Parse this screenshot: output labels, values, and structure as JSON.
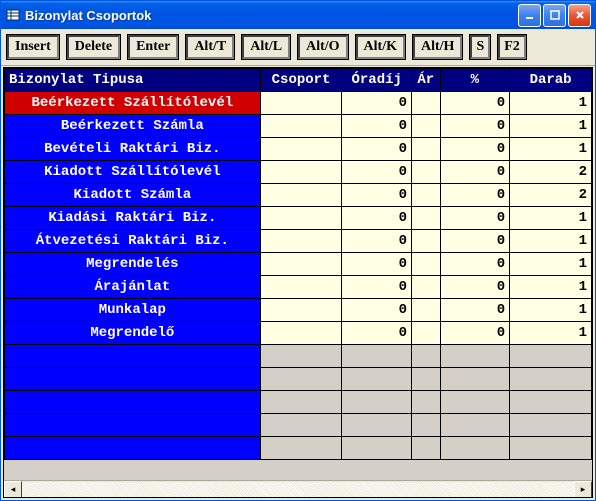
{
  "window": {
    "title": "Bizonylat Csoportok"
  },
  "toolbar": {
    "insert": "Insert",
    "delete": "Delete",
    "enter": "Enter",
    "altT": "Alt/T",
    "altL": "Alt/L",
    "altO": "Alt/O",
    "altK": "Alt/K",
    "altH": "Alt/H",
    "s": "S",
    "f2": "F2"
  },
  "headers": {
    "type": "Bizonylat Tipusa",
    "group": "Csoport",
    "hourly": "Óradíj",
    "price": "Ár",
    "percent": "%",
    "count": "Darab"
  },
  "rows": [
    {
      "type": "Beérkezett Szállítólevél",
      "group": "",
      "hourly": "0",
      "price": "",
      "percent": "0",
      "count": "1",
      "selected": true
    },
    {
      "type": "Beérkezett Számla",
      "group": "",
      "hourly": "0",
      "price": "",
      "percent": "0",
      "count": "1"
    },
    {
      "type": "Bevételi Raktári Biz.",
      "group": "",
      "hourly": "0",
      "price": "",
      "percent": "0",
      "count": "1"
    },
    {
      "type": "Kiadott Szállítólevél",
      "group": "",
      "hourly": "0",
      "price": "",
      "percent": "0",
      "count": "2"
    },
    {
      "type": "Kiadott Számla",
      "group": "",
      "hourly": "0",
      "price": "",
      "percent": "0",
      "count": "2"
    },
    {
      "type": "Kiadási Raktári Biz.",
      "group": "",
      "hourly": "0",
      "price": "",
      "percent": "0",
      "count": "1"
    },
    {
      "type": "Átvezetési Raktári Biz.",
      "group": "",
      "hourly": "0",
      "price": "",
      "percent": "0",
      "count": "1"
    },
    {
      "type": "Megrendelés",
      "group": "",
      "hourly": "0",
      "price": "",
      "percent": "0",
      "count": "1"
    },
    {
      "type": "Árajánlat",
      "group": "",
      "hourly": "0",
      "price": "",
      "percent": "0",
      "count": "1"
    },
    {
      "type": "Munkalap",
      "group": "",
      "hourly": "0",
      "price": "",
      "percent": "0",
      "count": "1"
    },
    {
      "type": "Megrendelő",
      "group": "",
      "hourly": "0",
      "price": "",
      "percent": "0",
      "count": "1"
    }
  ],
  "emptyRows": 5
}
